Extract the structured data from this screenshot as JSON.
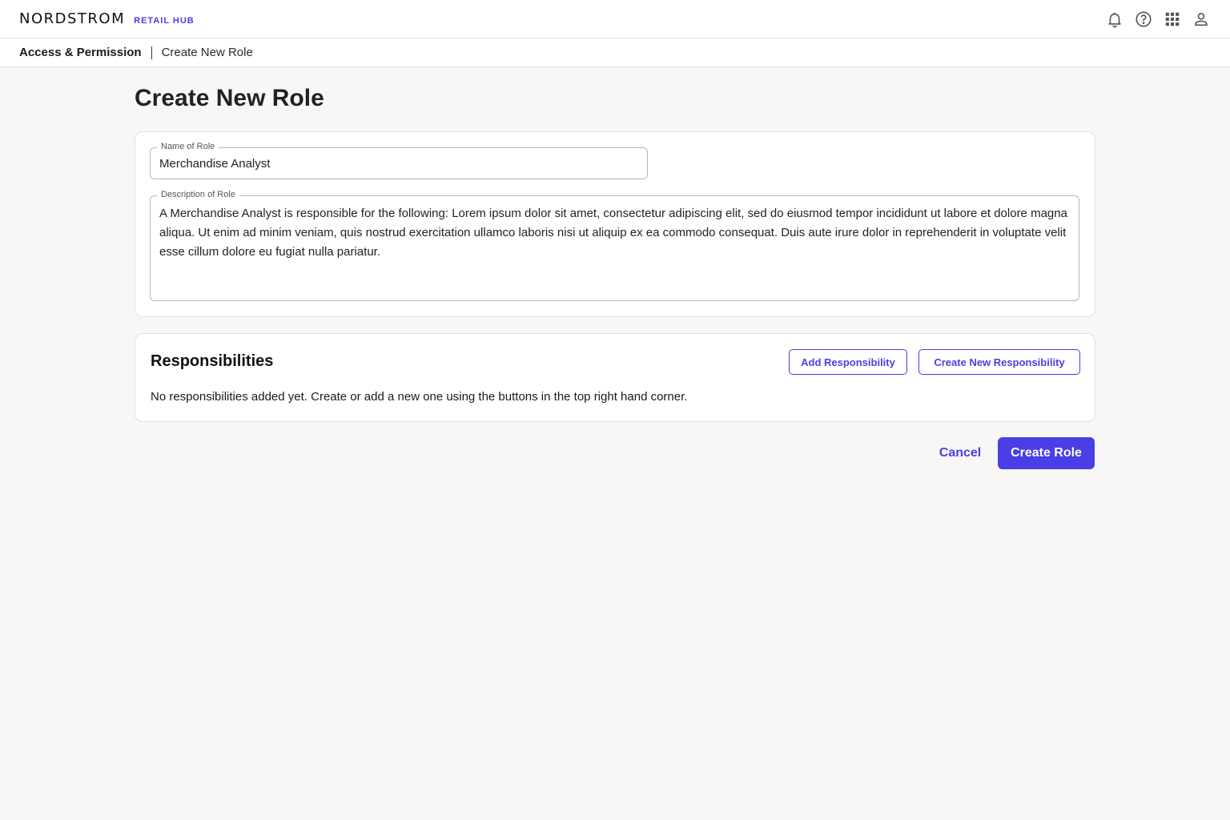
{
  "header": {
    "logo_text": "NORDSTROM",
    "app_name": "RETAIL HUB",
    "icons": [
      "bell-icon",
      "help-icon",
      "apps-grid-icon",
      "user-icon"
    ]
  },
  "breadcrumb": {
    "root": "Access & Permission",
    "current": "Create New Role"
  },
  "page": {
    "title": "Create New Role"
  },
  "role_form": {
    "name_label": "Name of Role",
    "name_value": "Merchandise Analyst",
    "description_label": "Description of Role",
    "description_value": "A Merchandise Analyst is responsible for the following: Lorem ipsum dolor sit amet, consectetur adipiscing elit, sed do eiusmod tempor incididunt ut labore et dolore magna aliqua. Ut enim ad minim veniam, quis nostrud exercitation ullamco laboris nisi ut aliquip ex ea commodo consequat. Duis aute irure dolor in reprehenderit in voluptate velit esse cillum dolore eu fugiat nulla pariatur."
  },
  "responsibilities": {
    "title": "Responsibilities",
    "add_button": "Add Responsibility",
    "create_button": "Create New Responsibility",
    "empty_message": "No responsibilities added yet. Create or add a new one using the buttons in the top right hand corner."
  },
  "actions": {
    "cancel": "Cancel",
    "submit": "Create Role"
  },
  "colors": {
    "accent": "#4a3ee6",
    "background": "#f8f7f5",
    "card": "#ffffff"
  }
}
